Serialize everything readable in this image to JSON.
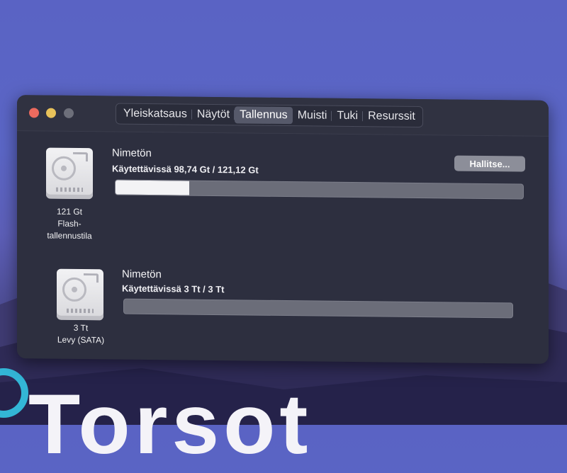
{
  "window": {
    "tabs": [
      {
        "label": "Yleiskatsaus",
        "active": false
      },
      {
        "label": "Näytöt",
        "active": false
      },
      {
        "label": "Tallennus",
        "active": true
      },
      {
        "label": "Muisti",
        "active": false
      },
      {
        "label": "Tuki",
        "active": false
      },
      {
        "label": "Resurssit",
        "active": false
      }
    ]
  },
  "disks": [
    {
      "name": "Nimetön",
      "available": "Käytettävissä 98,74 Gt / 121,12 Gt",
      "caption_lines": [
        "121 Gt",
        "Flash-",
        "tallennustila"
      ],
      "used_fraction": 0.18,
      "manage_label": "Hallitse..."
    },
    {
      "name": "Nimetön",
      "available": "Käytettävissä 3 Tt / 3 Tt",
      "caption_lines": [
        "3 Tt",
        "Levy (SATA)"
      ],
      "used_fraction": 0.0
    }
  ],
  "wallpaper": {
    "text": "Torsot"
  },
  "colors": {
    "accent_used": "#f3f3f5",
    "bar_free": "#6b6d79",
    "window_bg": "#2d2f3f"
  }
}
